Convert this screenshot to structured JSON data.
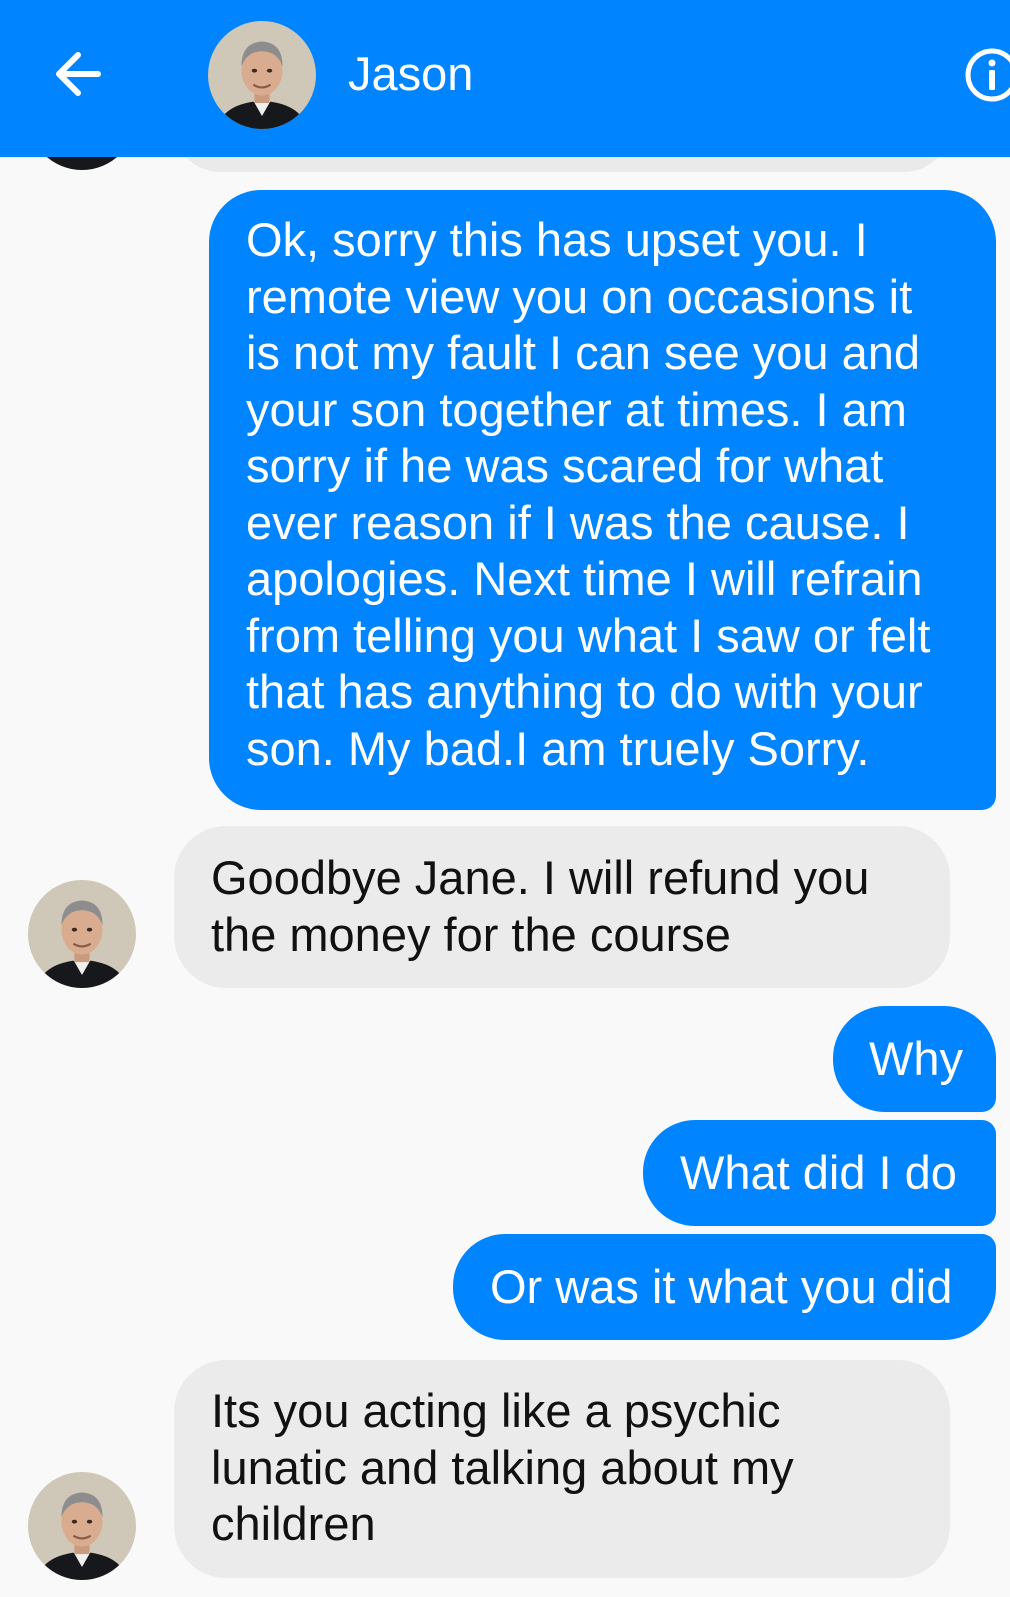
{
  "header": {
    "contact_name": "Jason",
    "back_icon": "arrow-left-icon",
    "info_icon": "info-icon",
    "avatar_icon": "contact-photo"
  },
  "colors": {
    "header_bg": "#0084ff",
    "outgoing_bubble": "#0084ff",
    "incoming_bubble": "#ebebeb",
    "background": "#f9f9f9"
  },
  "messages": [
    {
      "direction": "outgoing",
      "text": "Ok, sorry this has upset you. I\nremote view you on occasions it\nis not my fault I can see you and\nyour son together at times. I am\nsorry if he was scared for what\never reason if I was the cause. I\napologies. Next time I will refrain\nfrom telling you what I saw or felt\nthat has anything to do with your\nson. My bad.I am truely Sorry."
    },
    {
      "direction": "incoming",
      "text": "Goodbye Jane. I will refund you\nthe money for the course"
    },
    {
      "direction": "outgoing",
      "text": "Why"
    },
    {
      "direction": "outgoing",
      "text": "What did I do"
    },
    {
      "direction": "outgoing",
      "text": "Or was it what you did"
    },
    {
      "direction": "incoming",
      "text": "Its you acting like a psychic\nlunatic and talking about my\nchildren"
    }
  ]
}
